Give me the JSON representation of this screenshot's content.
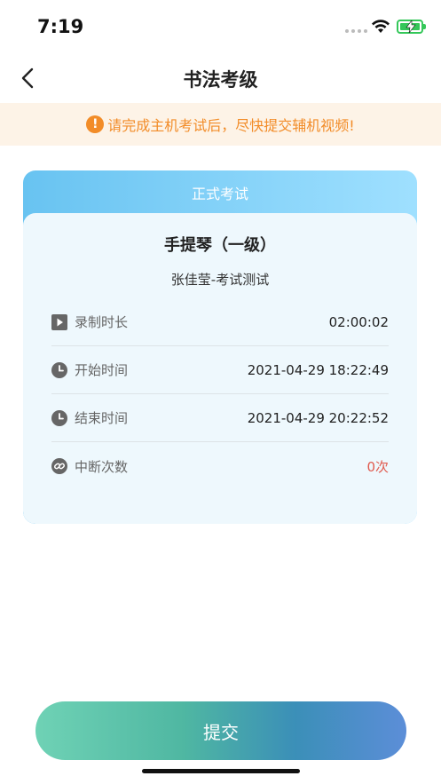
{
  "status_bar": {
    "time": "7:19"
  },
  "nav": {
    "title": "书法考级"
  },
  "notice": {
    "icon": "!",
    "text": "请完成主机考试后，尽快提交辅机视频!"
  },
  "card": {
    "header": "正式考试",
    "title": "手提琴（一级）",
    "subtitle": "张佳莹-考试测试",
    "rows": [
      {
        "icon": "play-icon",
        "label": "录制时长",
        "value": "02:00:02"
      },
      {
        "icon": "clock-icon",
        "label": "开始时间",
        "value": "2021-04-29 18:22:49"
      },
      {
        "icon": "clock-icon",
        "label": "结束时间",
        "value": "2021-04-29 20:22:52"
      },
      {
        "icon": "link-icon",
        "label": "中断次数",
        "value": "0次"
      }
    ]
  },
  "submit": {
    "label": "提交"
  },
  "colors": {
    "accent": "#68c3f1",
    "notice": "#f28c28",
    "warn_value": "#e05a4e"
  }
}
